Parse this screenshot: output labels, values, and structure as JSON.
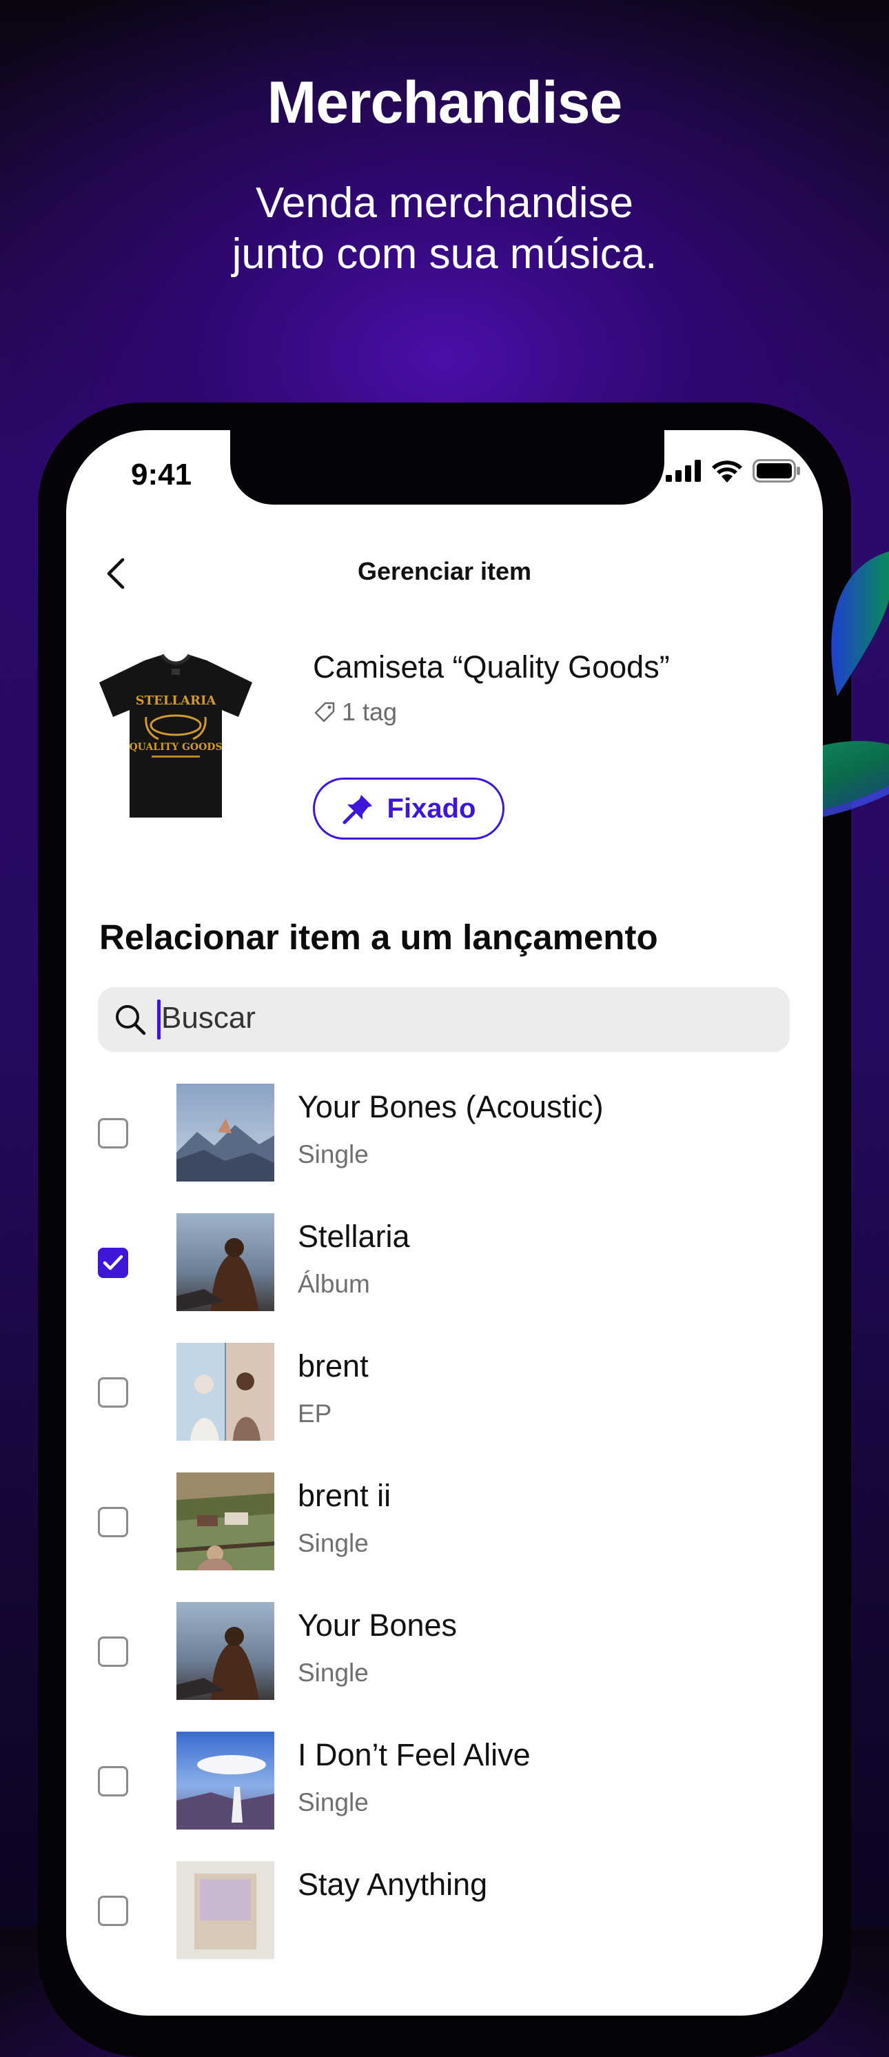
{
  "promo": {
    "title": "Merchandise",
    "subtitle_line1": "Venda merchandise",
    "subtitle_line2": "junto com sua música."
  },
  "status_bar": {
    "time": "9:41"
  },
  "nav": {
    "title": "Gerenciar item"
  },
  "product": {
    "name": "Camiseta “Quality Goods”",
    "tags": "1 tag",
    "pinned_label": "Fixado",
    "shirt_print": {
      "line1": "STELLARIA",
      "line2": "QUALITY GOODS"
    }
  },
  "section": {
    "title": "Relacionar item a um lançamento"
  },
  "search": {
    "placeholder": "Buscar"
  },
  "releases": [
    {
      "title": "Your Bones (Acoustic)",
      "type": "Single",
      "checked": false
    },
    {
      "title": "Stellaria",
      "type": "Álbum",
      "checked": true
    },
    {
      "title": "brent",
      "type": "EP",
      "checked": false
    },
    {
      "title": "brent ii",
      "type": "Single",
      "checked": false
    },
    {
      "title": "Your Bones",
      "type": "Single",
      "checked": false
    },
    {
      "title": "I Don’t Feel Alive",
      "type": "Single",
      "checked": false
    },
    {
      "title": "Stay Anything",
      "type": "",
      "checked": false
    }
  ],
  "colors": {
    "accent": "#3d16d8",
    "background_top": "#0b0612",
    "background_glow": "#4a0fa8"
  }
}
